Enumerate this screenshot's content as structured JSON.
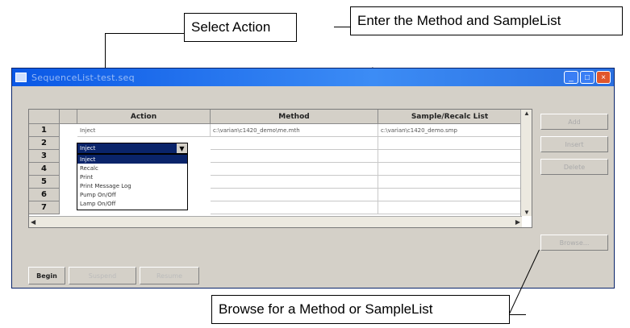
{
  "callouts": {
    "select_action": "Select Action",
    "enter_method": "Enter the Method and SampleList",
    "browse": "Browse for a Method or SampleList"
  },
  "window": {
    "title": "SequenceList-test.seq",
    "minimize": "_",
    "maximize": "□",
    "close": "×"
  },
  "grid": {
    "columns": [
      "Action",
      "Method",
      "Sample/Recalc List"
    ],
    "row_numbers": [
      "1",
      "2",
      "3",
      "4",
      "5",
      "6",
      "7"
    ],
    "rows": [
      {
        "action": "Inject",
        "method": "c:\\varian\\c1420_demo\\me.mth",
        "sample": "c:\\varian\\c1420_demo.smp"
      }
    ],
    "dropdown": {
      "current": "Inject",
      "options": [
        "Inject",
        "Recalc",
        "Print",
        "Print Message Log",
        "Pump On/Off",
        "Lamp On/Off"
      ]
    }
  },
  "side_buttons": [
    "Add",
    "Insert",
    "Delete",
    "Browse..."
  ],
  "bottom_buttons": [
    "Begin",
    "Suspend",
    "Resume"
  ],
  "colors": {
    "titlebar": "#0a58e6",
    "selection": "#0a246a",
    "window_bg": "#d4d0c8"
  }
}
